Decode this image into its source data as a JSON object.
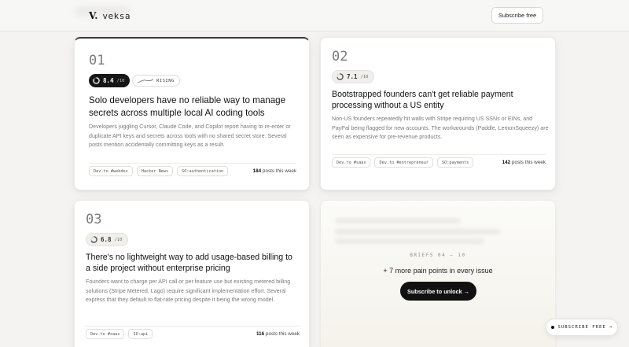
{
  "brand": {
    "mark": "V.",
    "name": "veksa"
  },
  "header": {
    "subscribe_label": "Subscribe free"
  },
  "cards": [
    {
      "num": "01",
      "score": "8.4",
      "score_max": "/10",
      "score_fraction": 0.84,
      "trend_label": "RISING",
      "title": "Solo developers have no reliable way to manage secrets across multiple local AI coding tools",
      "desc": "Developers juggling Cursor, Claude Code, and Copilot report having to re-enter or duplicate API keys and secrets across tools with no shared secret store. Several posts mention accidentally committing keys as a result.",
      "tags": [
        "Dev.to #webdev",
        "Hacker News",
        "SO:authentication"
      ],
      "posts_count": "184",
      "posts_suffix": " posts this week"
    },
    {
      "num": "02",
      "score": "7.1",
      "score_max": "/10",
      "score_fraction": 0.71,
      "title": "Bootstrapped founders can't get reliable payment processing without a US entity",
      "desc": "Non-US founders repeatedly hit walls with Stripe requiring US SSNs or EINs, and PayPal being flagged for new accounts. The workarounds (Paddle, LemonSqueezy) are seen as expensive for pre-revenue products.",
      "tags": [
        "Dev.to #saas",
        "Dev.to #entrepreneur",
        "SO:payments"
      ],
      "posts_count": "142",
      "posts_suffix": " posts this week"
    },
    {
      "num": "03",
      "score": "6.8",
      "score_max": "/10",
      "score_fraction": 0.68,
      "title": "There's no lightweight way to add usage-based billing to a side project without enterprise pricing",
      "desc": "Founders want to charge per API call or per feature use but existing metered billing solutions (Stripe Metered, Lago) require significant implementation effort. Several express that they default to flat-rate pricing despite it being the wrong model.",
      "tags": [
        "Dev.to #saas",
        "SO:api"
      ],
      "posts_count": "116",
      "posts_suffix": " posts this week"
    }
  ],
  "locked": {
    "briefs_label": "BRIEFS 04 – 10",
    "more_text": "+ 7 more pain points in every issue",
    "unlock_label": "Subscribe to unlock →"
  },
  "floating": {
    "label": "SUBSCRIBE FREE →"
  },
  "colors": {
    "accent": "#111111",
    "background": "#f4f3f1",
    "card": "#ffffff"
  }
}
